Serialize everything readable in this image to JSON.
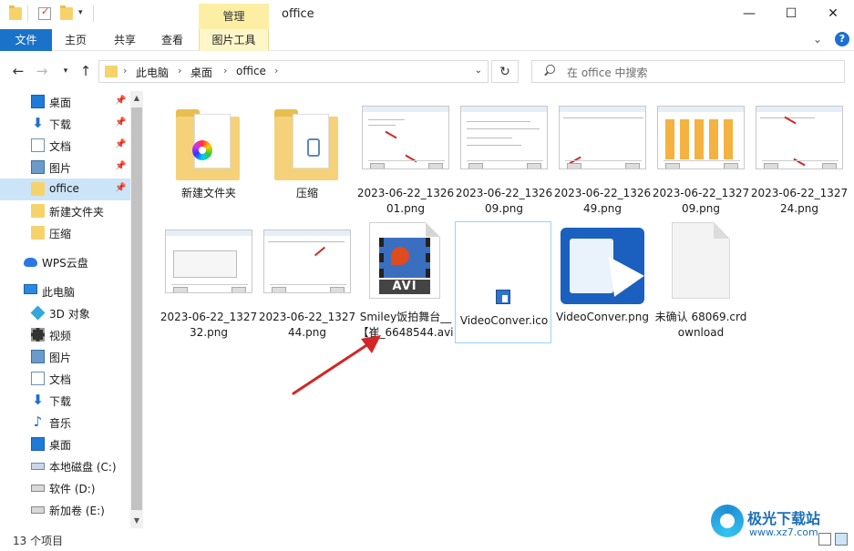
{
  "window": {
    "title": "office",
    "contextual_tab_group": "管理",
    "controls": {
      "minimize": "—",
      "maximize": "☐",
      "close": "✕"
    }
  },
  "ribbon": {
    "tabs": [
      "文件",
      "主页",
      "共享",
      "查看",
      "图片工具"
    ],
    "collapse_glyph": "⌄",
    "help": "?"
  },
  "address": {
    "breadcrumbs": [
      "此电脑",
      "桌面",
      "office"
    ],
    "search_placeholder": "在 office 中搜索"
  },
  "sidebar": {
    "items": [
      {
        "label": "桌面",
        "icon": "desktop-icon",
        "pinned": true
      },
      {
        "label": "下载",
        "icon": "download-icon",
        "pinned": true
      },
      {
        "label": "文档",
        "icon": "document-icon",
        "pinned": true
      },
      {
        "label": "图片",
        "icon": "picture-icon",
        "pinned": true
      },
      {
        "label": "office",
        "icon": "folder-icon",
        "pinned": true,
        "selected": true
      },
      {
        "label": "新建文件夹",
        "icon": "folder-icon"
      },
      {
        "label": "压缩",
        "icon": "folder-icon"
      },
      {
        "label": "WPS云盘",
        "icon": "cloud-icon"
      },
      {
        "label": "此电脑",
        "icon": "computer-icon"
      },
      {
        "label": "3D 对象",
        "icon": "3d-objects-icon"
      },
      {
        "label": "视频",
        "icon": "video-icon"
      },
      {
        "label": "图片",
        "icon": "picture-icon"
      },
      {
        "label": "文档",
        "icon": "document-icon"
      },
      {
        "label": "下载",
        "icon": "download-icon"
      },
      {
        "label": "音乐",
        "icon": "music-icon"
      },
      {
        "label": "桌面",
        "icon": "desktop-icon"
      },
      {
        "label": "本地磁盘 (C:)",
        "icon": "drive-c-icon"
      },
      {
        "label": "软件 (D:)",
        "icon": "drive-icon"
      },
      {
        "label": "新加卷 (E:)",
        "icon": "drive-icon"
      }
    ]
  },
  "files": [
    {
      "name": "新建文件夹",
      "kind": "folder"
    },
    {
      "name": "压缩",
      "kind": "folder"
    },
    {
      "name": "2023-06-22_132601.png",
      "kind": "image"
    },
    {
      "name": "2023-06-22_132609.png",
      "kind": "image"
    },
    {
      "name": "2023-06-22_132649.png",
      "kind": "image"
    },
    {
      "name": "2023-06-22_132709.png",
      "kind": "image"
    },
    {
      "name": "2023-06-22_132724.png",
      "kind": "image"
    },
    {
      "name": "2023-06-22_132732.png",
      "kind": "image"
    },
    {
      "name": "2023-06-22_132744.png",
      "kind": "image"
    },
    {
      "name": "Smiley饭拍舞台__【崔_6648544.avi",
      "kind": "video",
      "badge": "AVI"
    },
    {
      "name": "VideoConver.ico",
      "kind": "icon",
      "selected": true
    },
    {
      "name": "VideoConver.png",
      "kind": "image-logo"
    },
    {
      "name": "未确认 68069.crdownload",
      "kind": "blank"
    }
  ],
  "status": {
    "item_count": "13 个项目"
  },
  "watermark": {
    "title": "极光下载站",
    "url": "www.xz7.com"
  },
  "colors": {
    "accent": "#1a73c8",
    "selection": "#cce4f7",
    "manage_tab": "#fcefa4",
    "annotation": "#d32626"
  }
}
